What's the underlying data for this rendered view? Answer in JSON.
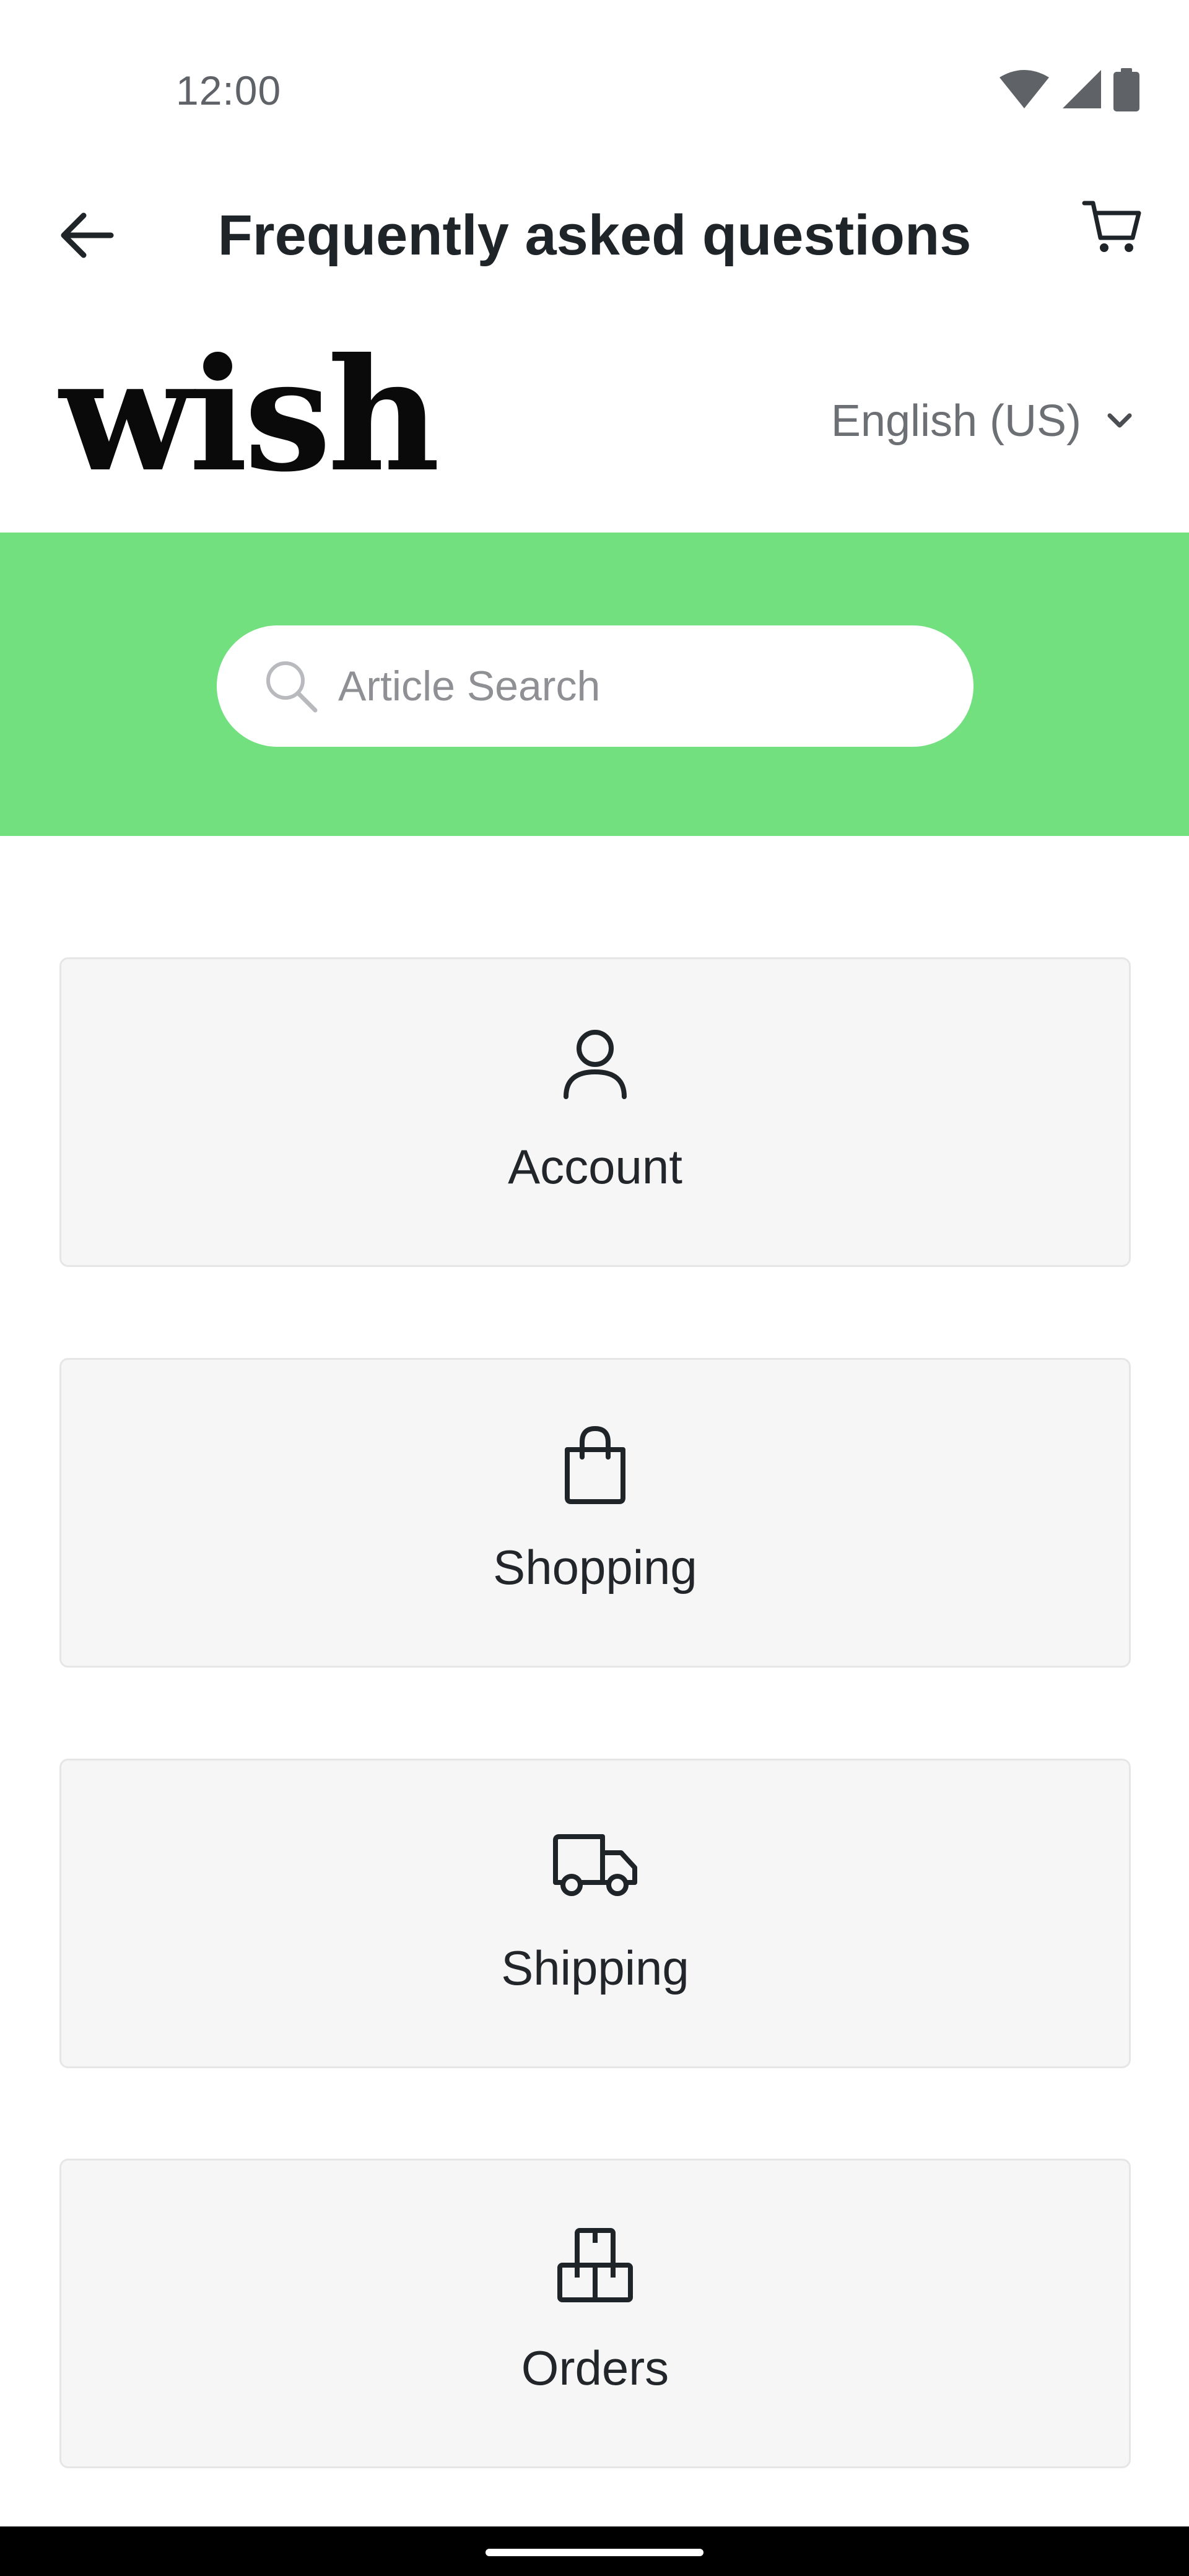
{
  "status_bar": {
    "time": "12:00"
  },
  "app_bar": {
    "title": "Frequently asked questions",
    "back_icon": "arrow-left-icon",
    "cart_icon": "shopping-cart-icon"
  },
  "brand": {
    "logo_text": "wish",
    "language": "English (US)"
  },
  "search": {
    "placeholder": "Article Search"
  },
  "categories": [
    {
      "label": "Account",
      "icon": "person-icon"
    },
    {
      "label": "Shopping",
      "icon": "shopping-bag-icon"
    },
    {
      "label": "Shipping",
      "icon": "truck-icon"
    },
    {
      "label": "Orders",
      "icon": "package-icon"
    }
  ],
  "colors": {
    "banner": "#73e07f",
    "card_background": "#f6f6f6",
    "text_dark": "#1f2428"
  }
}
